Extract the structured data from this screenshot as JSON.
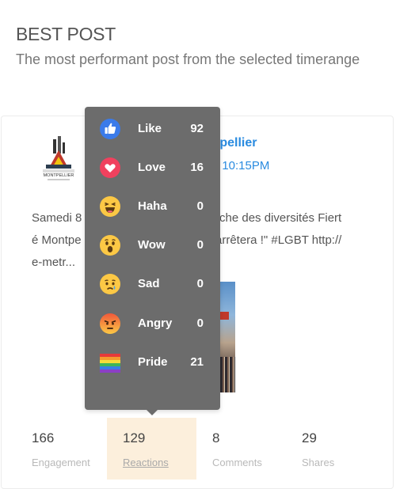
{
  "header": {
    "title": "BEST POST",
    "subtitle": "The most performant post from the selected timerange"
  },
  "post": {
    "logo_text": "MONTPELLIER",
    "author_visible": "tpellier",
    "time_visible": "t 10:15PM",
    "text_left_line1": "Samedi 8",
    "text_left_line2": "é Montpe",
    "text_left_line3": "e-metr...",
    "text_right_line1": "rche des diversités Fiert",
    "text_right_line2": "arrêtera !\" #LGBT http://"
  },
  "stats": [
    {
      "value": "166",
      "label": "Engagement"
    },
    {
      "value": "129",
      "label": "Reactions"
    },
    {
      "value": "8",
      "label": "Comments"
    },
    {
      "value": "29",
      "label": "Shares"
    }
  ],
  "reactions": [
    {
      "name": "Like",
      "count": "92",
      "icon": "like-icon"
    },
    {
      "name": "Love",
      "count": "16",
      "icon": "love-icon"
    },
    {
      "name": "Haha",
      "count": "0",
      "icon": "haha-icon"
    },
    {
      "name": "Wow",
      "count": "0",
      "icon": "wow-icon"
    },
    {
      "name": "Sad",
      "count": "0",
      "icon": "sad-icon"
    },
    {
      "name": "Angry",
      "count": "0",
      "icon": "angry-icon"
    },
    {
      "name": "Pride",
      "count": "21",
      "icon": "pride-flag-icon"
    }
  ],
  "colors": {
    "accent_blue": "#2a8be0",
    "tooltip_bg": "#6c6c6c",
    "active_stat_bg": "#fcefdc"
  }
}
